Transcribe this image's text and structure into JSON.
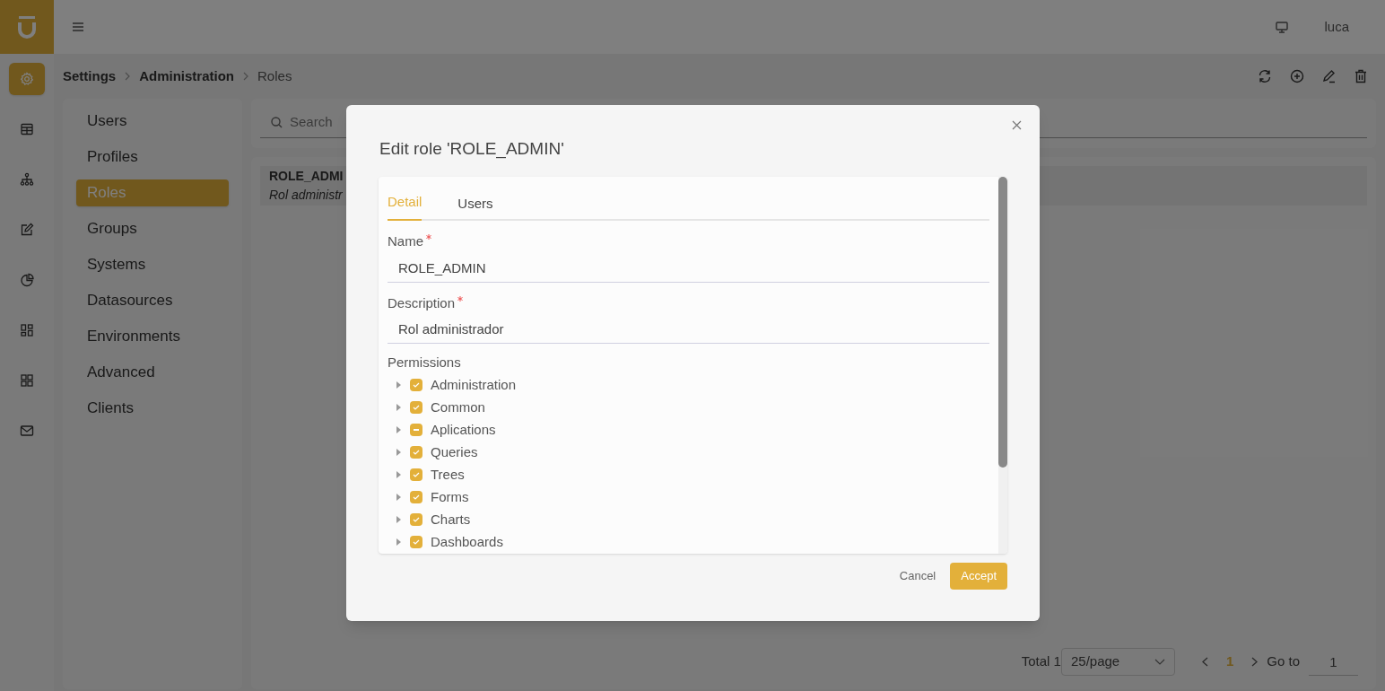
{
  "header": {
    "user": "luca"
  },
  "rail": [
    {
      "selected": true
    },
    {
      "selected": false
    },
    {
      "selected": false
    },
    {
      "selected": false
    },
    {
      "selected": false
    },
    {
      "selected": false
    },
    {
      "selected": false
    },
    {
      "selected": false
    }
  ],
  "breadcrumb": [
    {
      "label": "Settings",
      "current": false
    },
    {
      "label": "Administration",
      "current": false
    },
    {
      "label": "Roles",
      "current": true
    }
  ],
  "settings_menu": [
    {
      "label": "Users",
      "selected": false
    },
    {
      "label": "Profiles",
      "selected": false
    },
    {
      "label": "Roles",
      "selected": true
    },
    {
      "label": "Groups",
      "selected": false
    },
    {
      "label": "Systems",
      "selected": false
    },
    {
      "label": "Datasources",
      "selected": false
    },
    {
      "label": "Environments",
      "selected": false
    },
    {
      "label": "Advanced",
      "selected": false
    },
    {
      "label": "Clients",
      "selected": false
    }
  ],
  "search": {
    "placeholder": "Search"
  },
  "list": [
    {
      "name": "ROLE_ADMI",
      "description": "Rol administr"
    }
  ],
  "pagination": {
    "total": "Total 1",
    "page_size": "25/page",
    "pages": [
      {
        "label": "1",
        "selected": true
      }
    ],
    "goto_label": "Go to",
    "goto_value": "1"
  },
  "dialog": {
    "title": "Edit role 'ROLE_ADMIN'",
    "tabs": [
      {
        "label": "Detail",
        "selected": true
      },
      {
        "label": "Users",
        "selected": false
      }
    ],
    "fields": [
      {
        "label": "Name",
        "required": true,
        "value": "ROLE_ADMIN"
      },
      {
        "label": "Description",
        "required": true,
        "value": "Rol administrador"
      }
    ],
    "permissions_label": "Permissions",
    "permissions": [
      {
        "label": "Administration",
        "checked": true,
        "indeterminate": false,
        "expanded": false
      },
      {
        "label": "Common",
        "checked": true,
        "indeterminate": false,
        "expanded": false
      },
      {
        "label": "Aplications",
        "checked": false,
        "indeterminate": true,
        "expanded": false
      },
      {
        "label": "Queries",
        "checked": true,
        "indeterminate": false,
        "expanded": false
      },
      {
        "label": "Trees",
        "checked": true,
        "indeterminate": false,
        "expanded": false
      },
      {
        "label": "Forms",
        "checked": true,
        "indeterminate": false,
        "expanded": false
      },
      {
        "label": "Charts",
        "checked": true,
        "indeterminate": false,
        "expanded": false
      },
      {
        "label": "Dashboards",
        "checked": true,
        "indeterminate": false,
        "expanded": false
      }
    ],
    "buttons": [
      {
        "label": "Cancel",
        "kind": "text"
      },
      {
        "label": "Accept",
        "kind": "primary"
      }
    ]
  }
}
